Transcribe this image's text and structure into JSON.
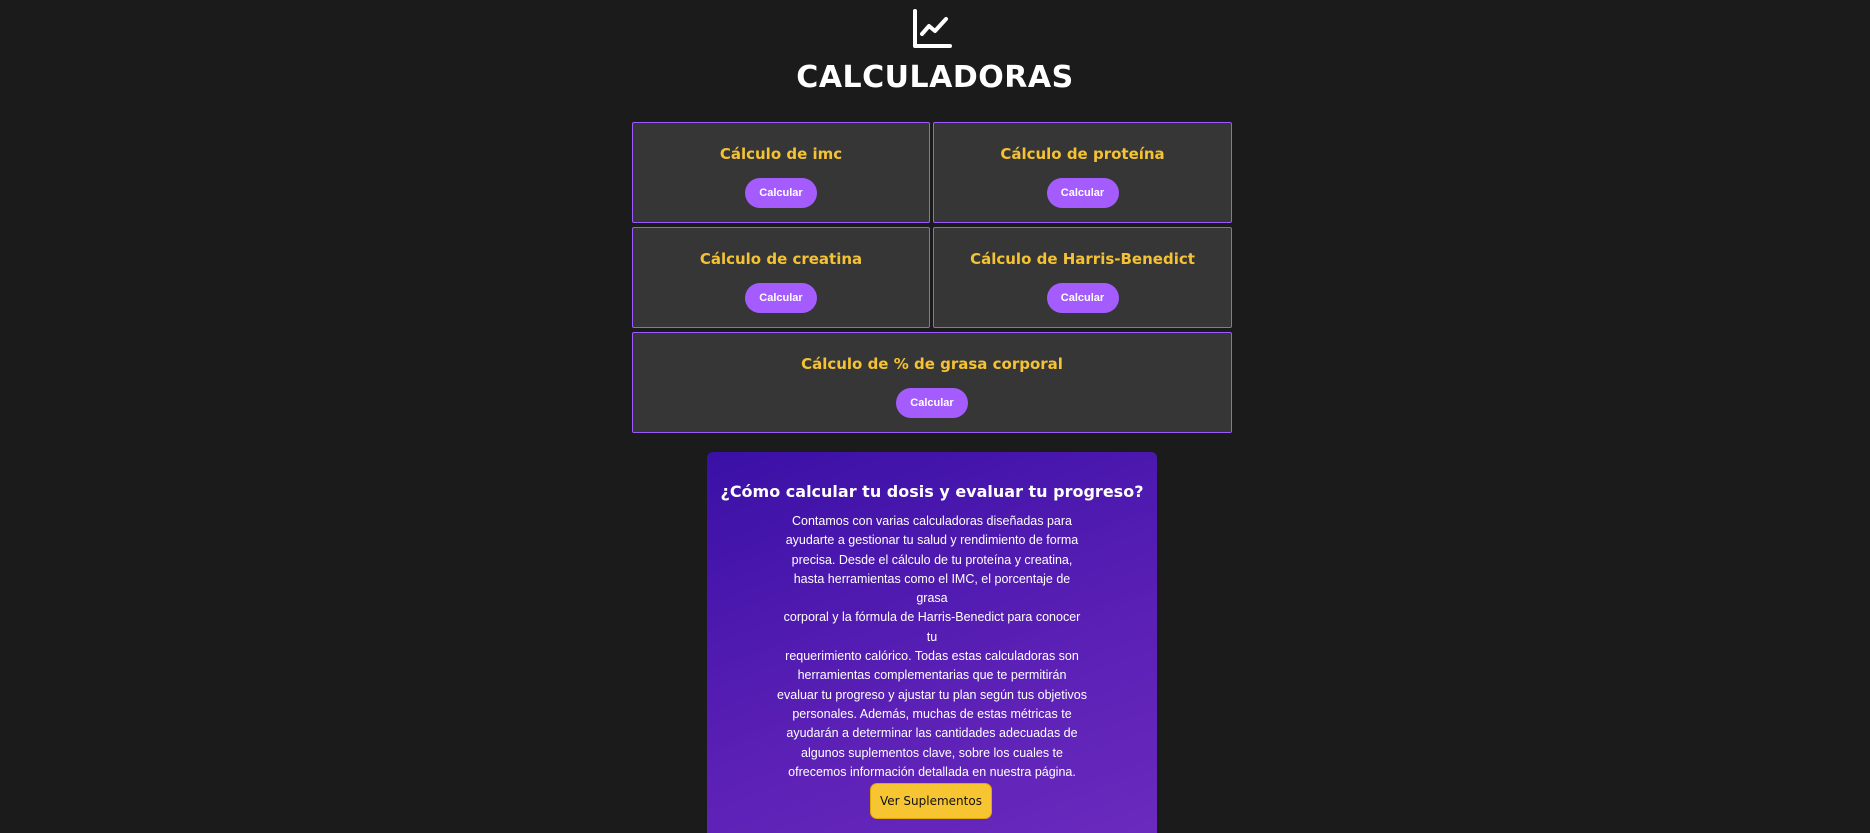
{
  "header": {
    "logo_icon": "chart-line-icon",
    "title": "CALCULADORAS"
  },
  "calculators": [
    {
      "title": "Cálculo de imc",
      "button": "Calcular"
    },
    {
      "title": "Cálculo de proteína",
      "button": "Calcular"
    },
    {
      "title": "Cálculo de creatina",
      "button": "Calcular"
    },
    {
      "title": "Cálculo de Harris-Benedict",
      "button": "Calcular"
    },
    {
      "title": "Cálculo de % de grasa corporal",
      "button": "Calcular"
    }
  ],
  "info": {
    "title": "¿Cómo calcular tu dosis y evaluar tu progreso?",
    "lines": [
      "Contamos con varias calculadoras diseñadas para",
      "ayudarte a gestionar tu salud y rendimiento de forma",
      "precisa. Desde el cálculo de tu proteína y creatina,",
      "hasta herramientas como el IMC, el porcentaje de grasa",
      "corporal y la fórmula de Harris-Benedict para conocer tu",
      "requerimiento calórico. Todas estas calculadoras son",
      "herramientas complementarias que te permitirán",
      "evaluar tu progreso y ajustar tu plan según tus objetivos",
      "personales. Además, muchas de estas métricas te",
      "ayudarán a determinar las cantidades adecuadas de",
      "algunos suplementos clave, sobre los cuales te",
      "ofrecemos información detallada en nuestra página."
    ],
    "button": "Ver Suplementos"
  },
  "colors": {
    "background": "#1b1b1b",
    "card_background": "#363636",
    "card_border": "#9b59ff",
    "card_title": "#f5c233",
    "button_purple": "#a45cff",
    "info_gradient_start": "#3a10a6",
    "info_gradient_end": "#6b2bbe",
    "button_yellow": "#f7c531"
  }
}
